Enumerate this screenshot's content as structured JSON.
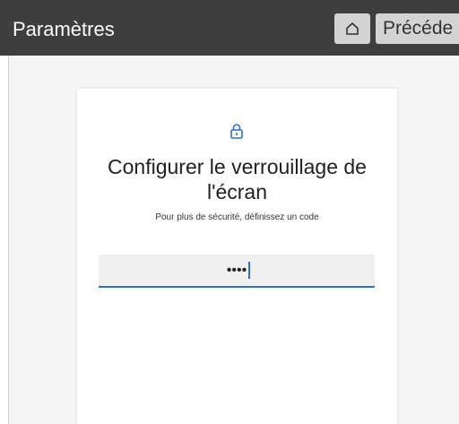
{
  "header": {
    "title": "Paramètres",
    "home_icon": "home-icon",
    "prev_label": "Précéde"
  },
  "lock_screen_setup": {
    "icon": "lock-icon",
    "heading": "Configurer le verrouillage de l'écran",
    "subtitle": "Pour plus de sécurité, définissez un code",
    "pin_value": "••••"
  },
  "colors": {
    "titlebar": "#3e3e3e",
    "button_bg": "#d3d3d3",
    "accent": "#2a6fd6",
    "field_bg": "#f0f0f0",
    "content_bg": "#f5f5f5"
  }
}
